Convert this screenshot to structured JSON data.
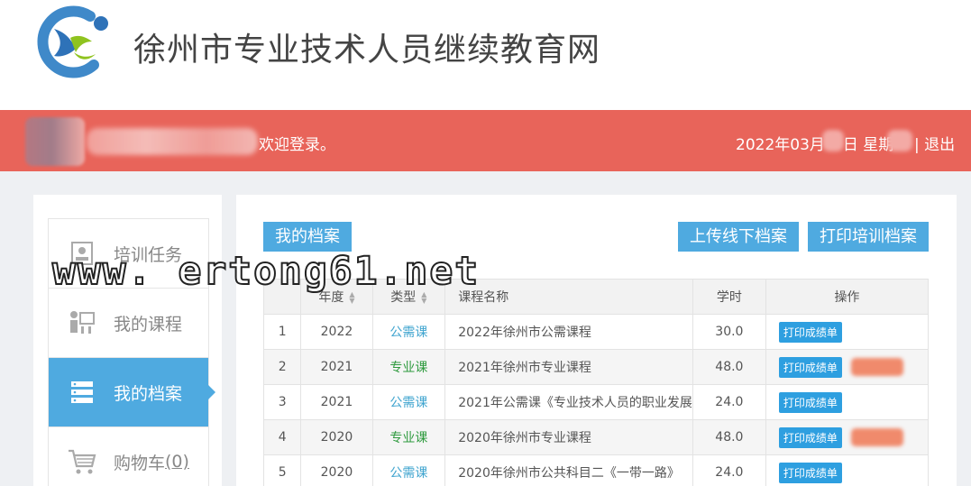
{
  "header": {
    "site_title": "徐州市专业技术人员继续教育网"
  },
  "topbar": {
    "welcome": "欢迎登录。",
    "date_prefix": "2022年03月",
    "day_suffix": "日 星期",
    "logout": "| 退出"
  },
  "sidebar": {
    "items": [
      {
        "label": "培训任务",
        "icon": "clipboard-icon"
      },
      {
        "label": "我的课程",
        "icon": "course-icon"
      },
      {
        "label": "我的档案",
        "icon": "archive-icon"
      },
      {
        "label": "购物车",
        "count": "(0)",
        "icon": "cart-icon"
      }
    ]
  },
  "main": {
    "btn_my_archive": "我的档案",
    "btn_upload_offline": "上传线下档案",
    "btn_print_training": "打印培训档案",
    "table": {
      "headers": [
        "",
        "年度",
        "类型",
        "课程名称",
        "学时",
        "操作"
      ],
      "print_label": "打印成绩单",
      "rows": [
        {
          "no": "1",
          "year": "2022",
          "type": "公需课",
          "name": "2022年徐州市公需课程",
          "hours": "30.0"
        },
        {
          "no": "2",
          "year": "2021",
          "type": "专业课",
          "name": "2021年徐州市专业课程",
          "hours": "48.0"
        },
        {
          "no": "3",
          "year": "2021",
          "type": "公需课",
          "name": "2021年公需课《专业技术人员的职业发展",
          "hours": "24.0"
        },
        {
          "no": "4",
          "year": "2020",
          "type": "专业课",
          "name": "2020年徐州市专业课程",
          "hours": "48.0"
        },
        {
          "no": "5",
          "year": "2020",
          "type": "公需课",
          "name": "2020年徐州市公共科目二《一带一路》",
          "hours": "24.0"
        }
      ]
    }
  },
  "watermark": "www. ertong61.net",
  "colors": {
    "accent": "#4faae0",
    "topbar": "#e8645a",
    "public_course": "#3fa4cf",
    "pro_course": "#2e9a3e"
  }
}
